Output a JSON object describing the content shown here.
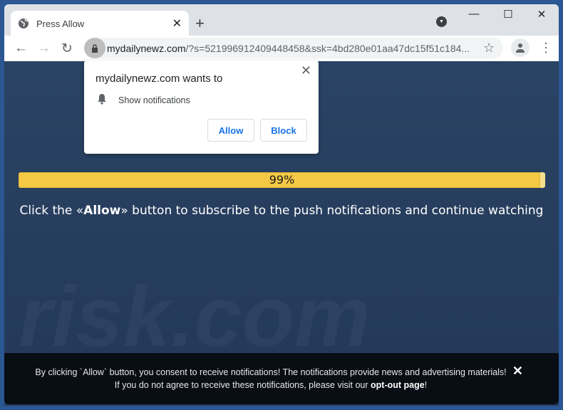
{
  "browser": {
    "tab_title": "Press Allow",
    "url_host": "mydailynewz.com",
    "url_rest": "/?s=521996912409448458&ssk=4bd280e01aa47dc15f51c184..."
  },
  "popup": {
    "heading": "mydailynewz.com wants to",
    "permission": "Show notifications",
    "allow_label": "Allow",
    "block_label": "Block"
  },
  "page": {
    "progress_percent": 99,
    "progress_label": "99%",
    "message_pre": "Click the «",
    "message_bold": "Allow",
    "message_post": "» button to subscribe to the push notifications and continue watching",
    "watermark": "risk.com"
  },
  "footer": {
    "text": "By clicking `Allow` button, you consent to receive notifications! The notifications provide news and advertising materials! If you do not agree to receive these notifications, please visit our ",
    "link": "opt-out page",
    "end": "!"
  },
  "colors": {
    "progress": "#f3c844",
    "background": "#263c5c",
    "accent": "#1a73e8"
  }
}
